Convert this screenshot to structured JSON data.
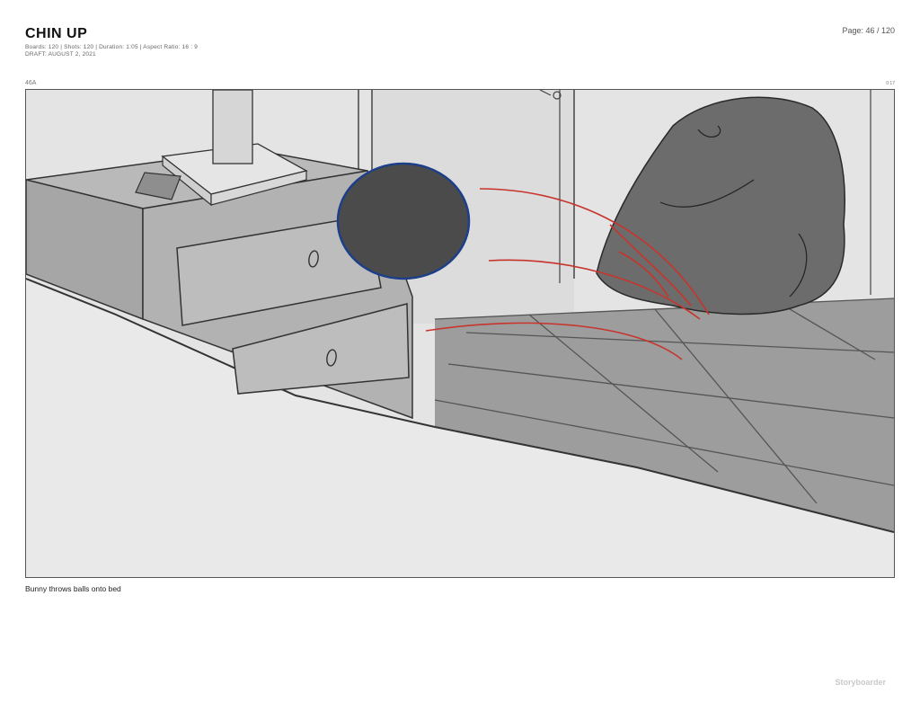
{
  "header": {
    "title": "CHIN UP",
    "meta_line1": "Boards: 120  |  Shots: 120  |  Duration: 1:05  |  Aspect Ratio: 16 : 9",
    "meta_line2": "DRAFT: AUGUST 2, 2021",
    "page": "Page: 46 / 120"
  },
  "board": {
    "shot": "46A",
    "duration": "0:17",
    "caption": "Bunny throws balls onto bed"
  },
  "footer": {
    "brand": "Storyboarder"
  }
}
